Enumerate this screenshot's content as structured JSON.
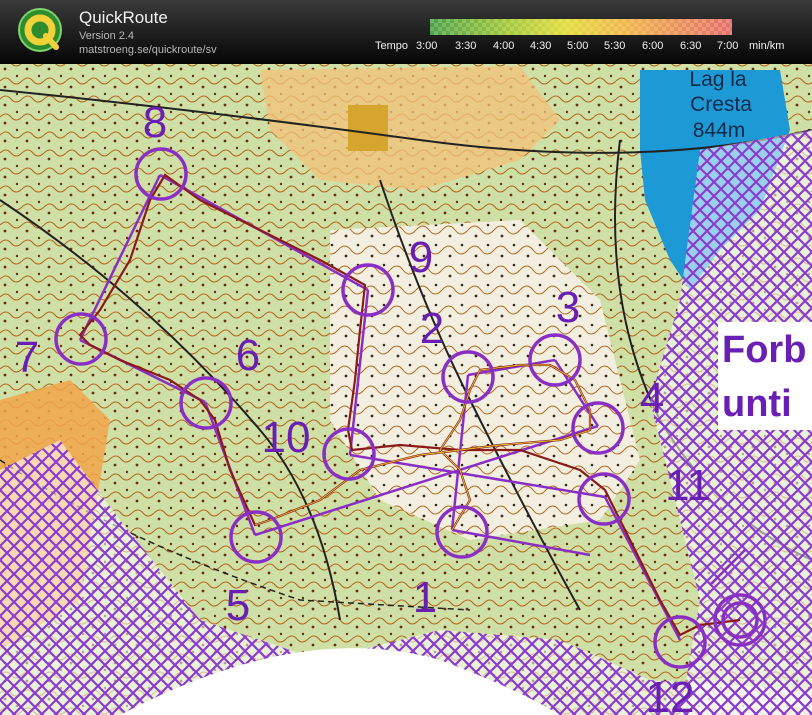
{
  "app": {
    "name": "QuickRoute",
    "version": "Version 2.4",
    "url": "matstroeng.se/quickroute/sv"
  },
  "tempo": {
    "label": "Tempo",
    "ticks": [
      "3:00",
      "3:30",
      "4:00",
      "4:30",
      "5:00",
      "5:30",
      "6:00",
      "6:30",
      "7:00"
    ],
    "unit": "min/km",
    "colors": [
      "#4ea24a",
      "#8cc13b",
      "#c9d935",
      "#f0d03a",
      "#eda046",
      "#e56e5c"
    ]
  },
  "map": {
    "lake_name": "Lag la",
    "lake_name_2": "Cresta",
    "lake_altitude": "844m",
    "warning_line1": "Forb",
    "warning_line2": "unti",
    "colors": {
      "control": "#8a2fc4",
      "route": "#8b1b1b",
      "lake": "#1d9ad6",
      "forbidden": "#8a3bd2",
      "open_land": "#f2a54a"
    },
    "controls": [
      {
        "label": "1"
      },
      {
        "label": "2"
      },
      {
        "label": "3"
      },
      {
        "label": "4"
      },
      {
        "label": "5"
      },
      {
        "label": "6"
      },
      {
        "label": "7"
      },
      {
        "label": "8"
      },
      {
        "label": "9"
      },
      {
        "label": "10"
      },
      {
        "label": "11"
      },
      {
        "label": "12"
      }
    ]
  }
}
